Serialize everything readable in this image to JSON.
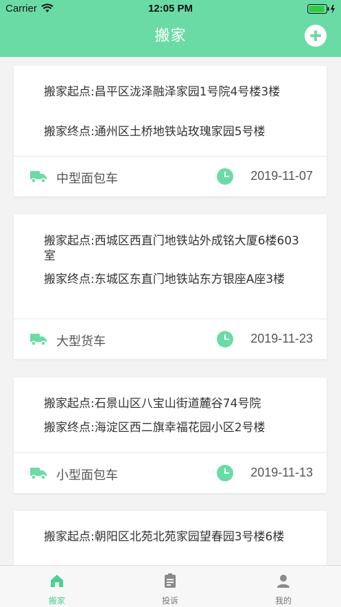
{
  "status_bar": {
    "carrier": "Carrier",
    "time": "12:05 PM"
  },
  "header": {
    "title": "搬家"
  },
  "colors": {
    "accent": "#6bdba6",
    "card_bg": "#ffffff",
    "page_bg": "#f3f3f3"
  },
  "orders": [
    {
      "start": "搬家起点:昌平区泷泽融泽家园1号院4号楼3楼",
      "end": "搬家终点:通州区土桥地铁站玫瑰家园5号楼",
      "vehicle": "中型面包车",
      "date": "2019-11-07"
    },
    {
      "start": "搬家起点:西城区西直门地铁站外成铭大厦6楼603室",
      "end": "搬家终点:东城区东直门地铁站东方银座A座3楼",
      "vehicle": "大型货车",
      "date": "2019-11-23"
    },
    {
      "start": "搬家起点:石景山区八宝山街道麓谷74号院",
      "end": "搬家终点:海淀区西二旗幸福花园小区2号楼",
      "vehicle": "小型面包车",
      "date": "2019-11-13"
    },
    {
      "start": "搬家起点:朝阳区北苑北苑家园望春园3号楼6楼"
    }
  ],
  "tabs": [
    {
      "label": "搬家",
      "icon": "home-icon",
      "active": true
    },
    {
      "label": "投诉",
      "icon": "clipboard-icon",
      "active": false
    },
    {
      "label": "我的",
      "icon": "user-icon",
      "active": false
    }
  ]
}
